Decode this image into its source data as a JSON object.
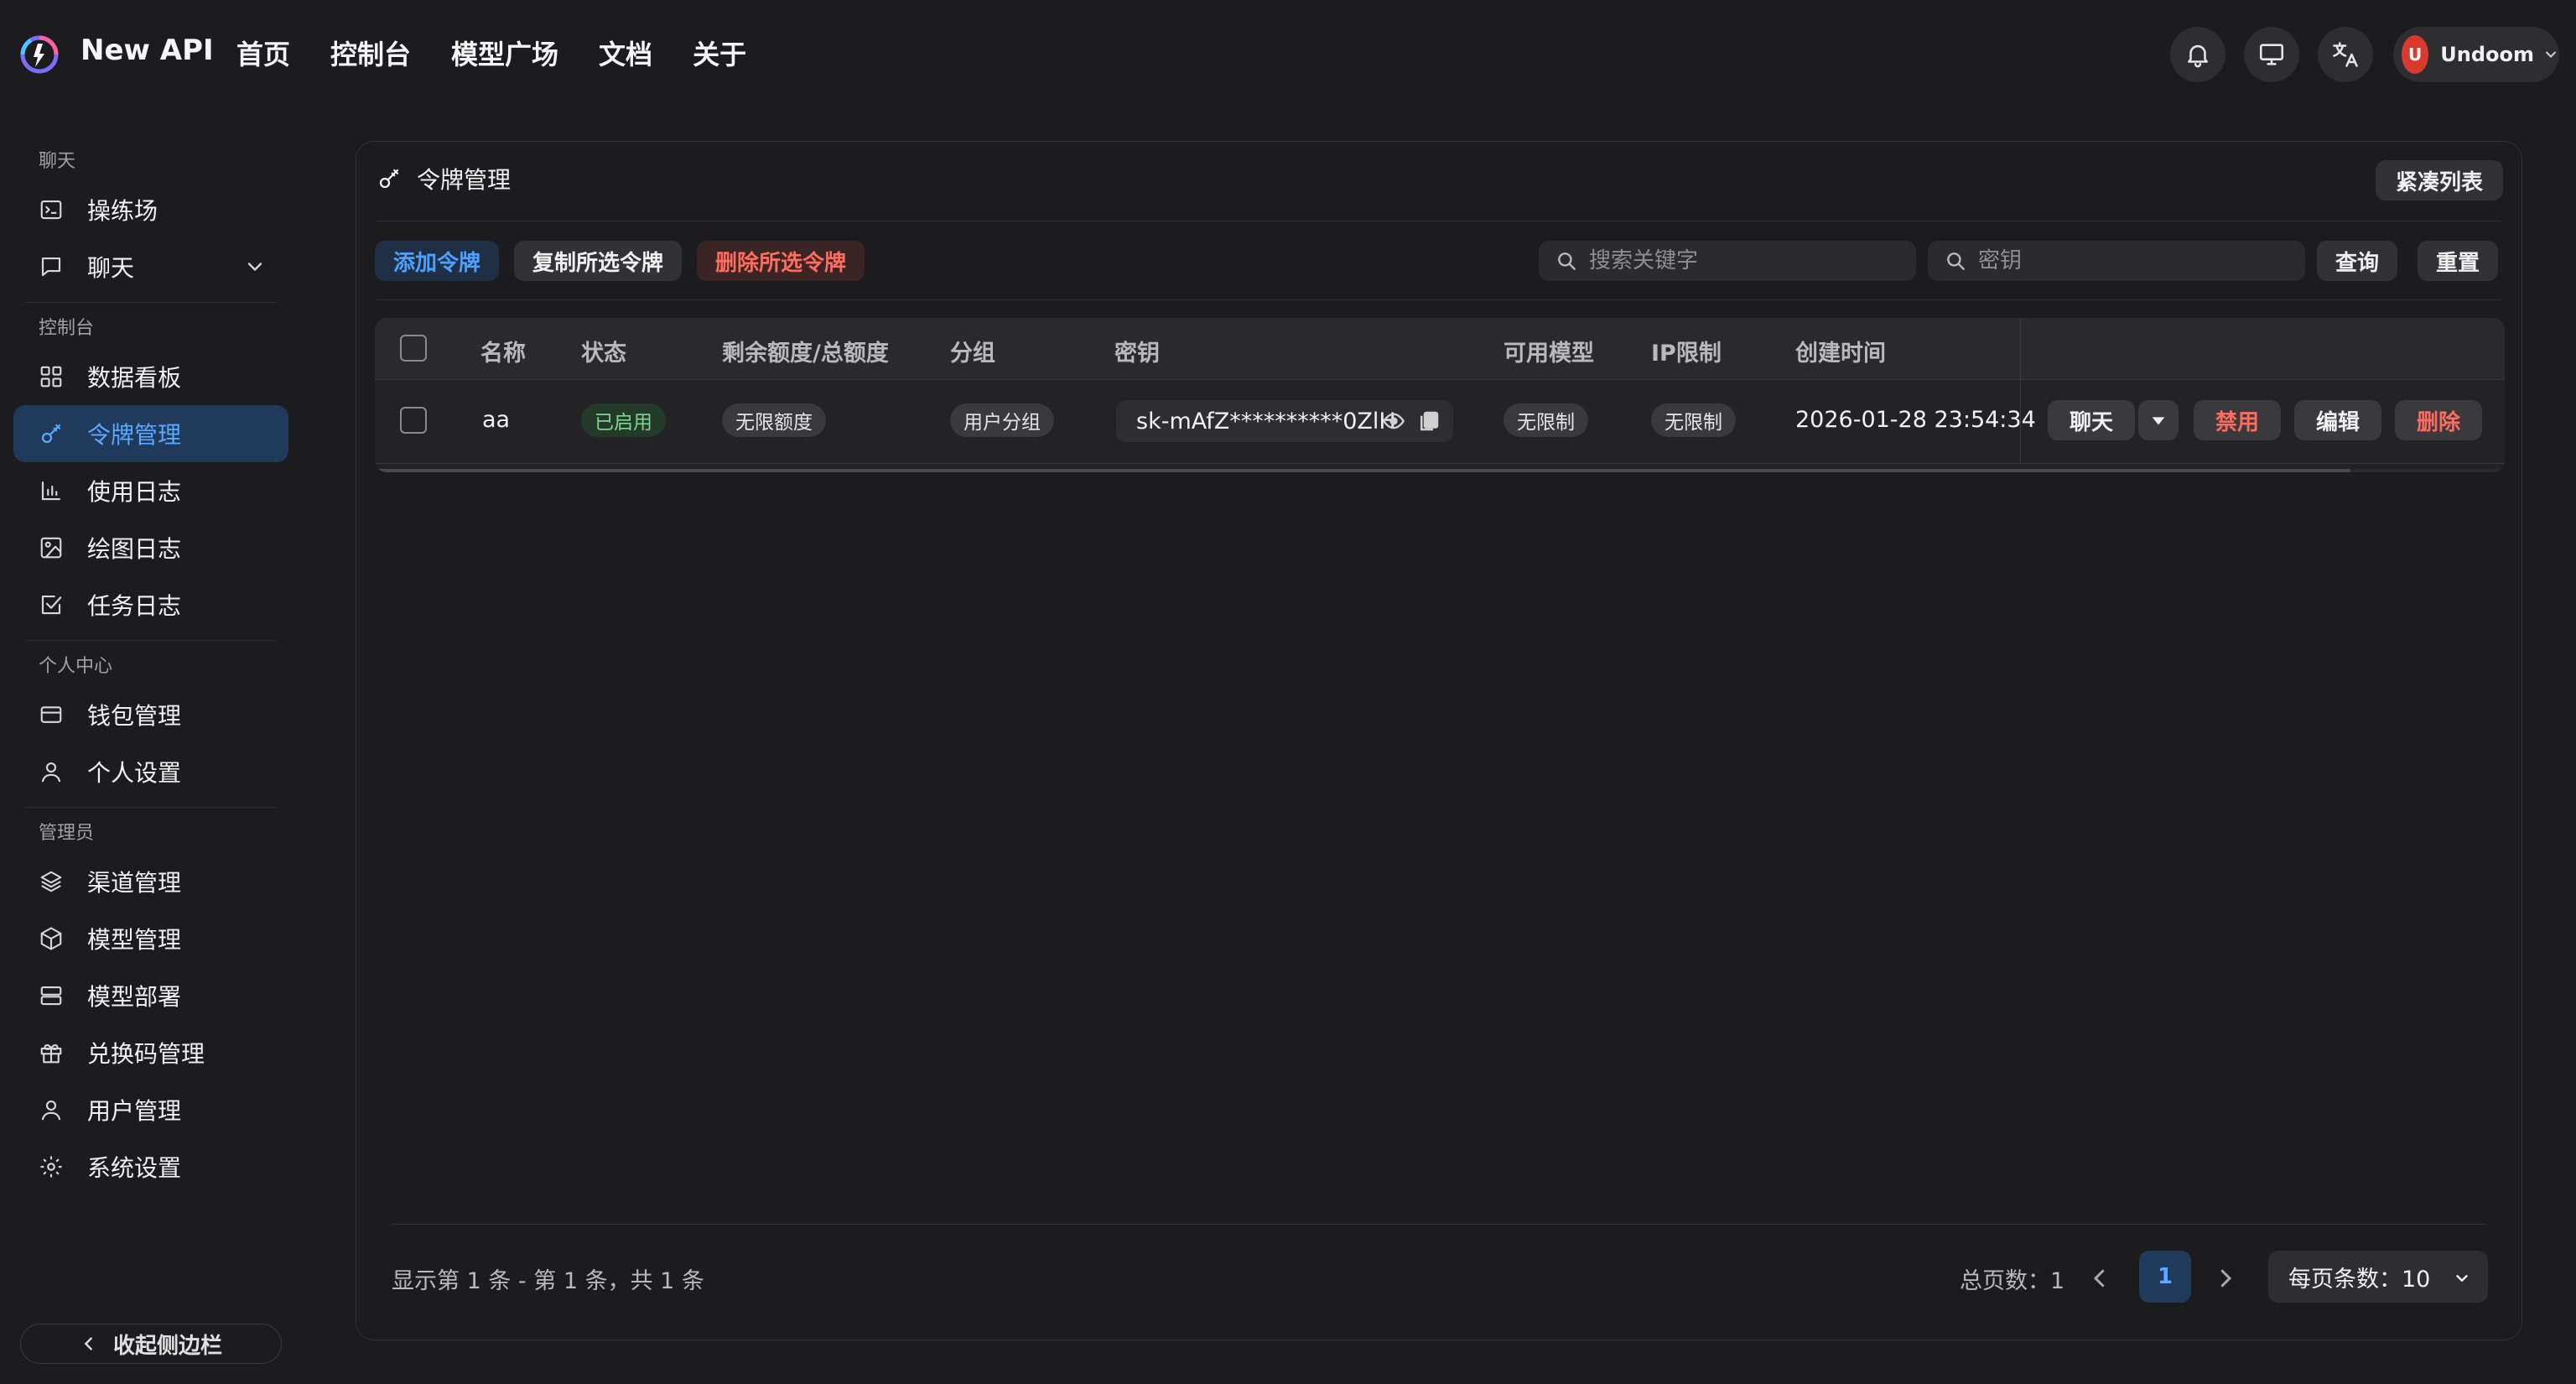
{
  "app": {
    "name": "New API",
    "nav": [
      "首页",
      "控制台",
      "模型广场",
      "文档",
      "关于"
    ]
  },
  "user": {
    "avatar_letter": "U",
    "name": "Undoom"
  },
  "sidebar": {
    "sections": [
      {
        "title": "聊天",
        "items": [
          {
            "label": "操练场",
            "icon": "playground-icon"
          },
          {
            "label": "聊天",
            "icon": "chat-icon",
            "expandable": true
          }
        ]
      },
      {
        "title": "控制台",
        "items": [
          {
            "label": "数据看板",
            "icon": "dashboard-icon"
          },
          {
            "label": "令牌管理",
            "icon": "key-icon",
            "active": true
          },
          {
            "label": "使用日志",
            "icon": "bar-chart-icon"
          },
          {
            "label": "绘图日志",
            "icon": "image-icon"
          },
          {
            "label": "任务日志",
            "icon": "task-check-icon"
          }
        ]
      },
      {
        "title": "个人中心",
        "items": [
          {
            "label": "钱包管理",
            "icon": "wallet-icon"
          },
          {
            "label": "个人设置",
            "icon": "user-icon"
          }
        ]
      },
      {
        "title": "管理员",
        "items": [
          {
            "label": "渠道管理",
            "icon": "layers-icon"
          },
          {
            "label": "模型管理",
            "icon": "box-icon"
          },
          {
            "label": "模型部署",
            "icon": "server-icon"
          },
          {
            "label": "兑换码管理",
            "icon": "gift-icon"
          },
          {
            "label": "用户管理",
            "icon": "user-icon"
          },
          {
            "label": "系统设置",
            "icon": "gear-icon"
          }
        ]
      }
    ],
    "collapse_label": "收起侧边栏"
  },
  "page": {
    "title": "令牌管理",
    "compact_label": "紧凑列表",
    "toolbar": {
      "add": "添加令牌",
      "copy": "复制所选令牌",
      "delete": "删除所选令牌"
    },
    "search": {
      "keyword_placeholder": "搜索关键字",
      "key_placeholder": "密钥",
      "query": "查询",
      "reset": "重置"
    },
    "table": {
      "headers": [
        "名称",
        "状态",
        "剩余额度/总额度",
        "分组",
        "密钥",
        "可用模型",
        "IP限制",
        "创建时间"
      ],
      "rows": [
        {
          "name": "aa",
          "status": "已启用",
          "quota": "无限额度",
          "group": "用户分组",
          "key": "sk-mAfZ**********0ZlH",
          "models": "无限制",
          "ip": "无限制",
          "created": "2026-01-28 23:54:34",
          "actions": {
            "chat": "聊天",
            "disable": "禁用",
            "edit": "编辑",
            "delete": "删除"
          }
        }
      ]
    },
    "footer": {
      "summary": "显示第 1 条 - 第 1 条，共 1 条",
      "total_pages": "总页数：1",
      "current_page": "1",
      "per_page": "每页条数：10"
    }
  },
  "colors": {
    "accent": "#5aa8ff",
    "danger": "#ff6b5e",
    "success": "#7fd48f",
    "background": "#1c1c1e"
  }
}
